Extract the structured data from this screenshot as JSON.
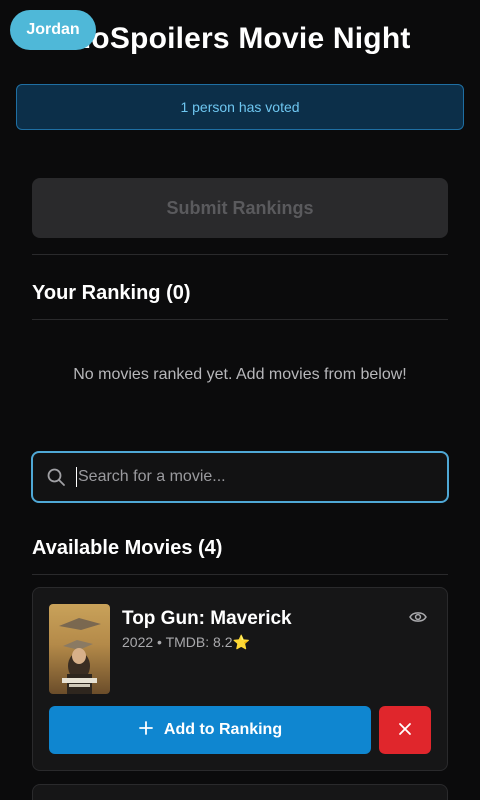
{
  "header": {
    "title": "NoSpoilers Movie Night",
    "user_name": "Jordan"
  },
  "vote_banner": {
    "text": "1 person has voted"
  },
  "submit": {
    "label": "Submit Rankings"
  },
  "ranking": {
    "title": "Your Ranking (0)",
    "empty_message": "No movies ranked yet. Add movies from below!"
  },
  "search": {
    "placeholder": "Search for a movie...",
    "value": ""
  },
  "available": {
    "title": "Available Movies (4)",
    "movies": [
      {
        "title": "Top Gun: Maverick",
        "meta": "2022 • TMDB: 8.2⭐",
        "add_label": "Add to Ranking"
      }
    ]
  },
  "icons": {
    "search": "search-icon",
    "eye": "eye-icon",
    "plus": "plus-icon",
    "close": "close-icon"
  },
  "colors": {
    "accent": "#0f86d0",
    "danger": "#e0262c",
    "badge": "#4fb8d8",
    "banner_bg": "#0c2f49",
    "banner_text": "#6ec6f0"
  }
}
